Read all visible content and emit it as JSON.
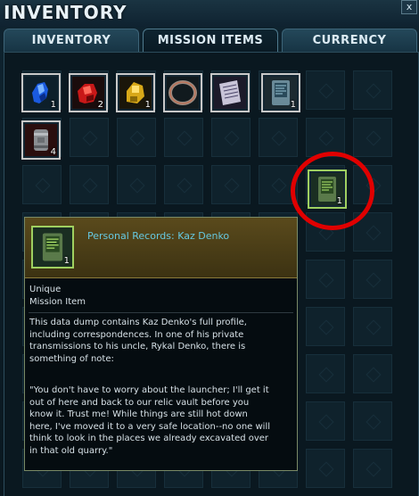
{
  "window": {
    "title": "INVENTORY",
    "close_label": "x"
  },
  "tabs": [
    {
      "label": "INVENTORY",
      "active": false
    },
    {
      "label": "MISSION ITEMS",
      "active": true
    },
    {
      "label": "CURRENCY",
      "active": false
    }
  ],
  "items": [
    {
      "name": "blue-crystal",
      "count": "1",
      "icon": "blue-crystal-icon"
    },
    {
      "name": "red-crystal",
      "count": "2",
      "icon": "red-crystal-icon"
    },
    {
      "name": "yellow-crystal",
      "count": "1",
      "icon": "yellow-crystal-icon"
    },
    {
      "name": "metal-ring",
      "count": "",
      "icon": "ring-icon"
    },
    {
      "name": "purple-document",
      "count": "",
      "icon": "document-icon"
    },
    {
      "name": "datapad",
      "count": "1",
      "icon": "datapad-icon"
    },
    {
      "name": "canister",
      "count": "4",
      "icon": "canister-icon"
    },
    {
      "name": "personal-records-kaz-denko",
      "count": "1",
      "icon": "green-datapad-icon"
    }
  ],
  "tooltip": {
    "item_name": "Personal Records: Kaz Denko",
    "count": "1",
    "tags": [
      "Unique",
      "Mission Item"
    ],
    "description": "This data dump contains Kaz Denko's full profile,\nincluding correspondences. In one of his private\ntransmissions to his uncle, Rykal Denko, there is\nsomething of note:",
    "quote": "\"You don't have to worry about the launcher; I'll get it\nout of here and back to our relic vault before you\nknow it. Trust me! While things are still hot down\nhere, I've moved it to a very safe location--no one will\nthink to look in the places we already excavated over\nin that old quarry.\""
  },
  "colors": {
    "highlight_ring": "#e00000",
    "item_name": "#66c8e0",
    "tooltip_header": "#5a4a1c"
  }
}
